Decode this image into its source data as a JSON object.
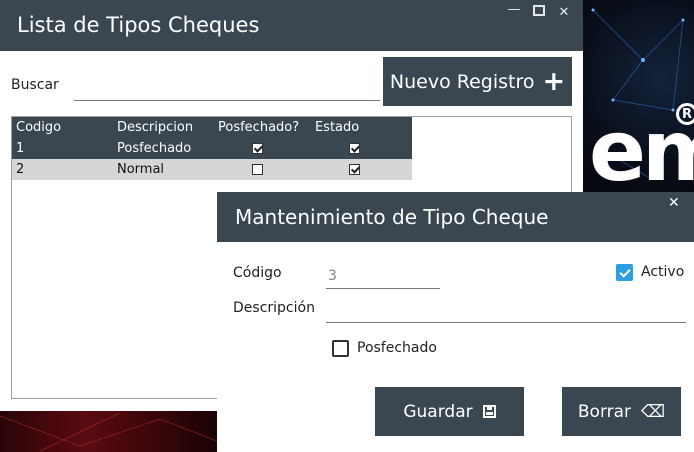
{
  "main_window": {
    "title": "Lista de Tipos Cheques",
    "search_label": "Buscar",
    "search_value": "",
    "new_button_label": "Nuevo Registro",
    "table": {
      "columns": [
        "Codigo",
        "Descripcion",
        "Posfechado?",
        "Estado"
      ],
      "rows": [
        {
          "codigo": "1",
          "descripcion": "Posfechado",
          "posfechado": true,
          "estado": true,
          "selected": true
        },
        {
          "codigo": "2",
          "descripcion": "Normal",
          "posfechado": false,
          "estado": true,
          "selected": false
        }
      ]
    }
  },
  "modal": {
    "title": "Mantenimiento de Tipo Cheque",
    "codigo_label": "Código",
    "codigo_value": "3",
    "activo_label": "Activo",
    "activo_checked": true,
    "descripcion_label": "Descripción",
    "descripcion_value": "",
    "posfechado_label": "Posfechado",
    "posfechado_checked": false,
    "save_label": "Guardar",
    "delete_label": "Borrar"
  },
  "icons": {
    "plus": "plus-icon",
    "save": "floppy-disk-icon",
    "backspace": "backspace-icon",
    "close": "close-icon"
  },
  "colors": {
    "header": "#3a4750",
    "checkbox_accent": "#2d9fe0",
    "row_alt": "#d6d6d6"
  }
}
